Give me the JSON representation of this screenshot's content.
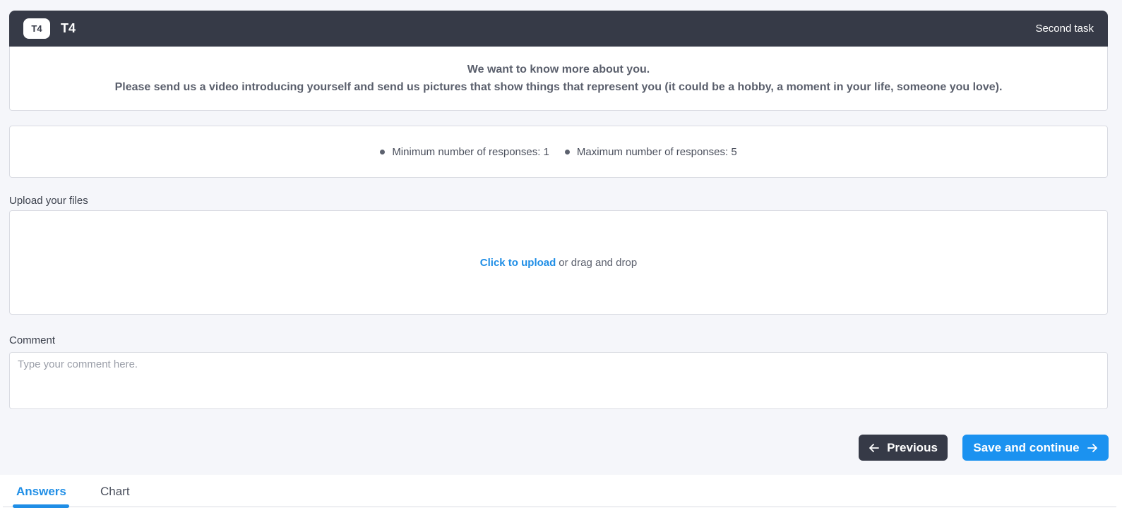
{
  "task": {
    "badge": "T4",
    "code": "T4",
    "name": "Second task"
  },
  "instructions": {
    "line1": "We want to know more about you.",
    "line2": "Please send us a video introducing yourself and send us pictures that show things that represent you (it could be a hobby, a moment in your life, someone you love)."
  },
  "limits": {
    "min": "Minimum number of responses: 1",
    "max": "Maximum number of responses: 5"
  },
  "upload": {
    "label": "Upload your files",
    "link_text": "Click to upload",
    "rest_text": "or drag and drop"
  },
  "comment": {
    "label": "Comment",
    "placeholder": "Type your comment here.",
    "value": ""
  },
  "nav": {
    "previous_label": "Previous",
    "save_label": "Save and continue"
  },
  "tabs": [
    {
      "label": "Answers",
      "active": true
    },
    {
      "label": "Chart",
      "active": false
    }
  ],
  "colors": {
    "header_bg": "#363a47",
    "accent": "#1b92f0",
    "page_bg": "#f5f6fa"
  }
}
